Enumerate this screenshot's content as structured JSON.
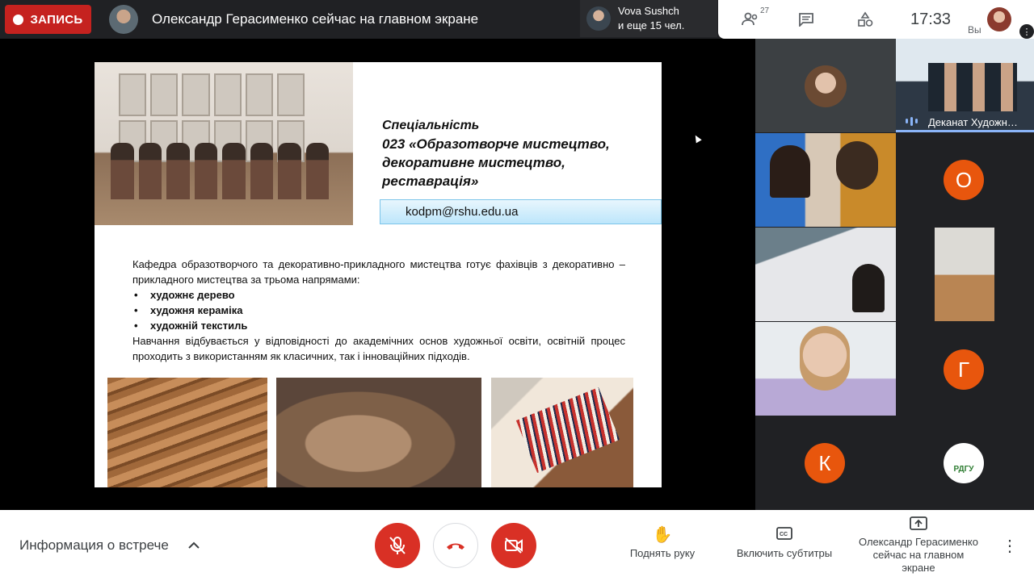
{
  "topbar": {
    "record_label": "ЗАПИСЬ",
    "presenting_text": "Олександр Герасименко сейчас на главном экране",
    "people_line1": "Vova Sushch",
    "people_line2": "и еще 15 чел.",
    "participants_count": "27",
    "time": "17:33",
    "self_label": "Вы",
    "icons": [
      "people-icon",
      "chat-icon",
      "activities-icon"
    ]
  },
  "slide": {
    "spec_title": "Спеціальність",
    "spec_name_lines": [
      "023 «Образотворче мистецтво,",
      "декоративне мистецтво,",
      "реставрація»"
    ],
    "email": "kodpm@rshu.edu.ua",
    "paragraph1": "Кафедра образотворчого та декоративно-прикладного мистецтва  готує фахівців з декоративно – прикладного мистецтва за трьома напрямами:",
    "items": [
      "художнє дерево",
      "художня кераміка",
      "художній текстиль"
    ],
    "paragraph2": "Навчання відбувається у відповідності до академічних основ художньої освіти, освітній процес проходить з використанням як класичних, так і інноваційних підходів."
  },
  "participants": {
    "dekanat_name": "Деканат Художн…",
    "avatar_o": "О",
    "avatar_g": "Г",
    "avatar_k": "К",
    "logo_text": "РДГУ",
    "colors": {
      "orange_avatar": "#e8560d",
      "accent_blue": "#8ab4f8",
      "rec_red": "#c5221f",
      "ctl_red": "#d93025"
    }
  },
  "bottombar": {
    "info_label": "Информация о встрече",
    "raise_hand": "Поднять руку",
    "captions": "Включить субтитры",
    "presenting_lines": [
      "Олександр Герасименко",
      "сейчас на главном",
      "экране"
    ]
  }
}
